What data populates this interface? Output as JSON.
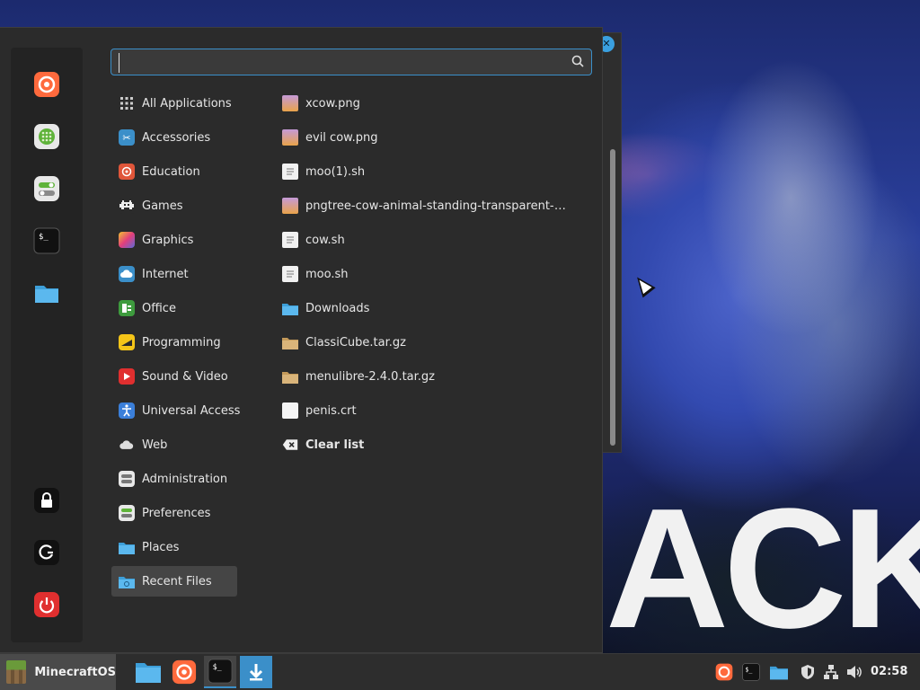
{
  "search": {
    "value": "",
    "placeholder": ""
  },
  "favorites": [
    {
      "name": "firefox-icon"
    },
    {
      "name": "software-manager-icon"
    },
    {
      "name": "settings-icon"
    },
    {
      "name": "terminal-icon"
    },
    {
      "name": "files-icon"
    }
  ],
  "session": [
    {
      "name": "lock-screen-icon"
    },
    {
      "name": "logout-icon"
    },
    {
      "name": "shutdown-icon"
    }
  ],
  "categories": [
    {
      "label": "All Applications"
    },
    {
      "label": "Accessories"
    },
    {
      "label": "Education"
    },
    {
      "label": "Games"
    },
    {
      "label": "Graphics"
    },
    {
      "label": "Internet"
    },
    {
      "label": "Office"
    },
    {
      "label": "Programming"
    },
    {
      "label": "Sound & Video"
    },
    {
      "label": "Universal Access"
    },
    {
      "label": "Web"
    },
    {
      "label": "Administration"
    },
    {
      "label": "Preferences"
    },
    {
      "label": "Places"
    },
    {
      "label": "Recent Files",
      "selected": true
    }
  ],
  "recent_files": [
    {
      "label": "xcow.png",
      "kind": "image"
    },
    {
      "label": "evil cow.png",
      "kind": "image"
    },
    {
      "label": "moo(1).sh",
      "kind": "script"
    },
    {
      "label": "pngtree-cow-animal-standing-transparent-o…",
      "kind": "image"
    },
    {
      "label": "cow.sh",
      "kind": "script"
    },
    {
      "label": "moo.sh",
      "kind": "script"
    },
    {
      "label": "Downloads",
      "kind": "folder"
    },
    {
      "label": "ClassiCube.tar.gz",
      "kind": "archive"
    },
    {
      "label": "menulibre-2.4.0.tar.gz",
      "kind": "archive"
    },
    {
      "label": "penis.crt",
      "kind": "document"
    }
  ],
  "clear_list": {
    "label": "Clear list"
  },
  "panel": {
    "menu_label": "MinecraftOS",
    "clock": "02:58"
  },
  "wallpaper": {
    "text": "ACK"
  },
  "colors": {
    "accent": "#3b8fc9",
    "menu_bg": "#2b2b2b",
    "panel_bg": "#2d2d2d"
  }
}
